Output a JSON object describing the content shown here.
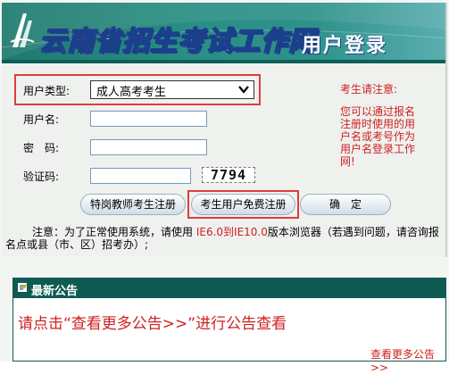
{
  "banner": {
    "title": "云南省招生考试工作网",
    "subtitle": "用户登录"
  },
  "form": {
    "user_type_label": "用户类型:",
    "user_type_value": "成人高考考生",
    "username_label": "用户名:",
    "password_label": "密　码:",
    "captcha_label": "验证码:",
    "captcha_text": "7794",
    "btn_teacher": "特岗教师考生注册",
    "btn_register": "考生用户免费注册",
    "btn_confirm": "确　定"
  },
  "notice": {
    "title": "考生请注意:",
    "body": "您可以通过报名注册时使用的用户名或考号作为用户名登录工作网!"
  },
  "note": {
    "prefix": "注意：为了正常使用系统，请使用 ",
    "versions": "IE6.0到IE10.0",
    "suffix": "版本浏览器（若遇到问题，请咨询报名点或县（市、区）招考办）;"
  },
  "announcement": {
    "title": "最新公告",
    "message": "请点击“查看更多公告>>”进行公告查看",
    "more_link": "查看更多公告>>"
  },
  "colors": {
    "accent_teal": "#0f5a52",
    "alert_red": "#d01f1f",
    "highlight_red": "#e23b3b"
  }
}
